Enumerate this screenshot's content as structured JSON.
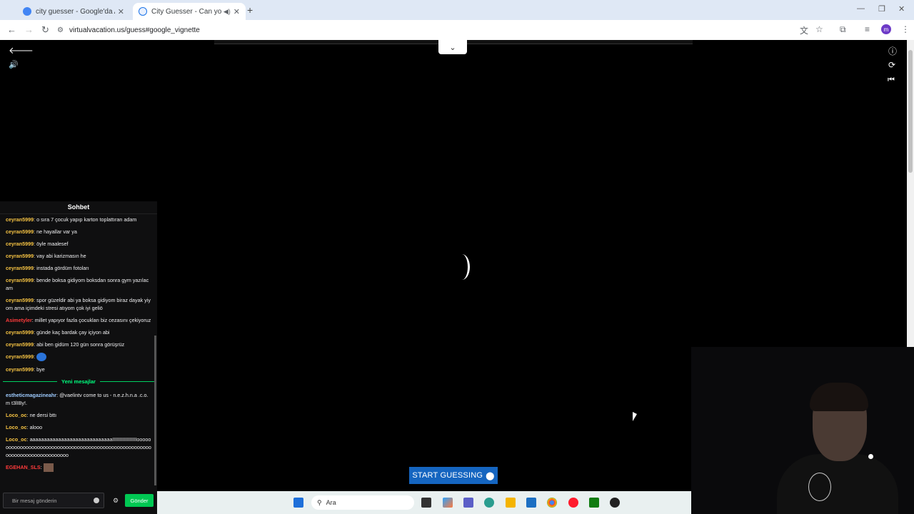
{
  "browser": {
    "tabs": [
      {
        "title": "city guesser - Google'da Ara",
        "active": false
      },
      {
        "title": "City Guesser - Can you gue",
        "active": true
      }
    ],
    "url": "virtualvacation.us/guess#google_vignette"
  },
  "page": {
    "start_button": "START GUESSING",
    "colors": {
      "start_button": "#1565c0"
    }
  },
  "chat": {
    "title": "Sohbet",
    "messages_before": [
      {
        "user": "ceyran5999",
        "color": "#f6c343",
        "text": "o sıra 7 çocuk yapıp karton toplattıran adam"
      },
      {
        "user": "ceyran5999",
        "color": "#f6c343",
        "text": "ne hayallar var ya"
      },
      {
        "user": "ceyran5999",
        "color": "#f6c343",
        "text": "öyle maalesef"
      },
      {
        "user": "ceyran5999",
        "color": "#f6c343",
        "text": "vay abi karizmasın he"
      },
      {
        "user": "ceyran5999",
        "color": "#f6c343",
        "text": "instada gördüm fotoları"
      },
      {
        "user": "ceyran5999",
        "color": "#f6c343",
        "text": "bende boksa gidiyom boksdan sonra gym yazılacam"
      },
      {
        "user": "ceyran5999",
        "color": "#f6c343",
        "text": "spor güzeldir abi ya boksa gidiyom biraz dayak yiyom ama içimdeki stresi atıyom çok iyi geliö"
      },
      {
        "user": "Asimetyler",
        "color": "#ff3b3b",
        "text": "millet yapıyor fazla çocukları biz cezasını çekiyoruz"
      },
      {
        "user": "ceyran5999",
        "color": "#f6c343",
        "text": "günde kaç bardak çay içiyon abi"
      },
      {
        "user": "ceyran5999",
        "color": "#f6c343",
        "text": "abi ben gidüm 120 gün sonra görüşrüz"
      },
      {
        "user": "ceyran5999",
        "color": "#f6c343",
        "text": ""
      },
      {
        "user": "ceyran5999",
        "color": "#f6c343",
        "text": "bye"
      }
    ],
    "new_messages_label": "Yeni mesajlar",
    "messages_after": [
      {
        "user": "estheticmagazineahr",
        "color": "#9ecbff",
        "text": "@vaelintv come to us - n.e.z.h.n.a .c.o.m t3lIBy!."
      },
      {
        "user": "Loco_oc",
        "color": "#f6c343",
        "text": "ne dersi bttı"
      },
      {
        "user": "Loco_oc",
        "color": "#f6c343",
        "text": "alooo"
      },
      {
        "user": "Loco_oc",
        "color": "#f6c343",
        "text": "aaaaaaaaaaaaaaaaaaaaaaaaaaaaaIIIIIIIIIIIIIIIIIoooooooooooooooooooooooooooooooooooooooooooooooooooooooooooooooooooooooooooooo"
      },
      {
        "user": "EGEHAN_SLS",
        "color": "#ff3b3b",
        "text": ""
      }
    ],
    "input_placeholder": "Bir mesaj gönderin",
    "send_label": "Gönder"
  },
  "taskbar": {
    "search_placeholder": "Ara"
  }
}
